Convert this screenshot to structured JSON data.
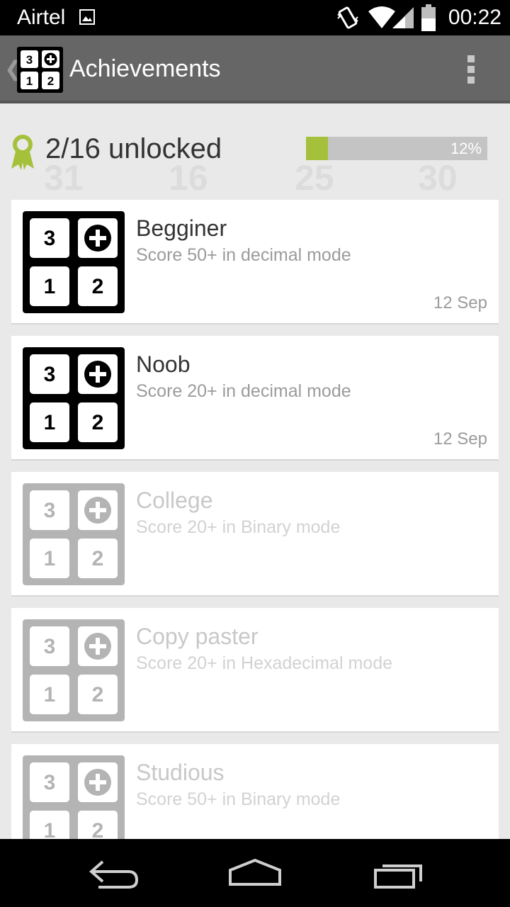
{
  "status_bar": {
    "carrier": "Airtel",
    "time": "00:22",
    "icons": [
      "gallery-icon",
      "vibrate-icon",
      "wifi-icon",
      "signal-icon",
      "battery-icon"
    ]
  },
  "action_bar": {
    "title": "Achievements",
    "logo_tiles": [
      "3",
      "+",
      "1",
      "2"
    ]
  },
  "summary": {
    "unlocked_text": "2/16 unlocked",
    "progress_fraction": 0.12,
    "progress_label": "12%"
  },
  "background_numbers": [
    "31",
    "16",
    "25",
    "30"
  ],
  "achievements": [
    {
      "name": "Begginer",
      "description": "Score 50+ in decimal mode",
      "date": "12 Sep",
      "unlocked": true
    },
    {
      "name": "Noob",
      "description": "Score 20+ in decimal mode",
      "date": "12 Sep",
      "unlocked": true
    },
    {
      "name": "College",
      "description": "Score 20+ in Binary mode",
      "date": "",
      "unlocked": false
    },
    {
      "name": "Copy paster",
      "description": "Score 20+ in Hexadecimal mode",
      "date": "",
      "unlocked": false
    },
    {
      "name": "Studious",
      "description": "Score 50+ in Binary mode",
      "date": "",
      "unlocked": false
    }
  ],
  "colors": {
    "action_bar": "#666666",
    "accent_green": "#a5c13b",
    "unlocked_tile_bg": "#000000",
    "locked_tile_bg": "#b4b4b4"
  }
}
